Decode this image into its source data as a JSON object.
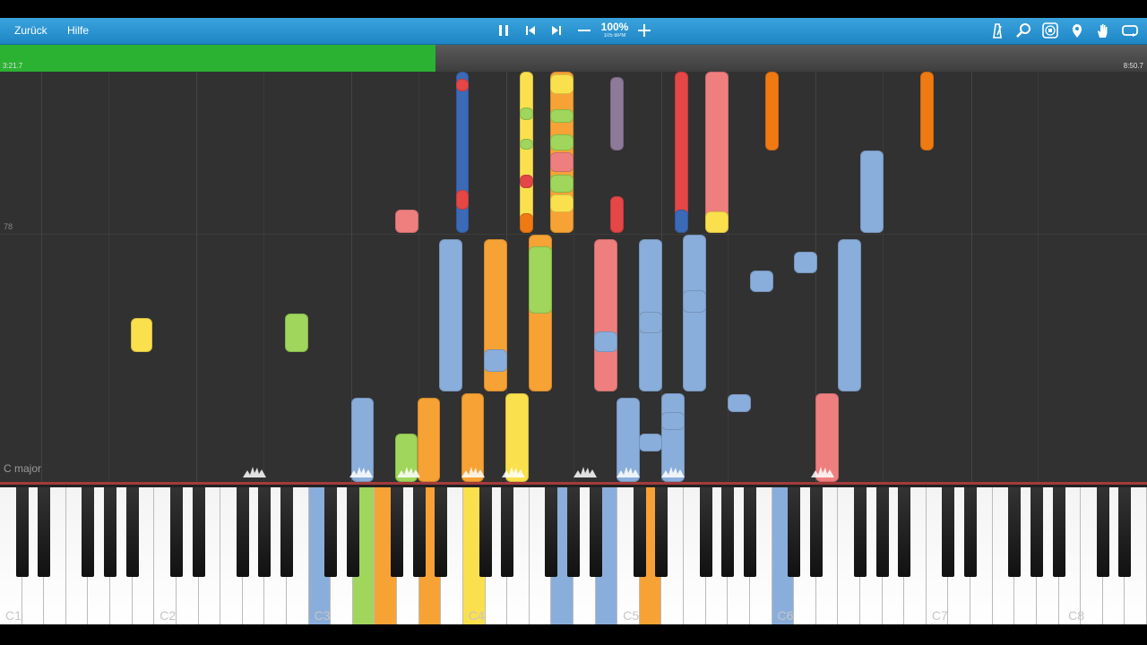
{
  "toolbar": {
    "back_label": "Zurück",
    "help_label": "Hilfe",
    "zoom_percent": "100%",
    "bpm_label": "105 BPM",
    "left_icons": [
      "pause-icon",
      "skip-back-icon",
      "skip-forward-icon",
      "minus-icon",
      "plus-icon"
    ],
    "right_icons": [
      "metronome-icon",
      "search-icon",
      "label-icon",
      "location-pin-icon",
      "hand-icon",
      "loop-icon"
    ]
  },
  "progress": {
    "elapsed": "3:21.7",
    "total": "8:50.7",
    "fraction": 0.38,
    "color": "#2bb233"
  },
  "roll": {
    "measure_number": "78",
    "key_signature": "C major",
    "colors": {
      "blue": "#8aaedb",
      "orange": "#f7a234",
      "green": "#9fd65b",
      "yellow": "#fbe04d",
      "pink": "#ef7f7f",
      "red": "#e54646",
      "purple": "#8e7a98",
      "darkblue": "#3a6ab8",
      "deeporange": "#f07a12"
    }
  },
  "keyboard": {
    "octave_labels": [
      "C1",
      "C2",
      "C3",
      "C4",
      "C5",
      "C6",
      "C7",
      "C8"
    ],
    "active_colors": {
      "C3": "#8aaedb",
      "E3": "#9fd65b",
      "F3": "#f7a234",
      "A3": "#f7a234",
      "C4": "#fbe04d",
      "G4": "#8aaedb",
      "B4": "#8aaedb",
      "D5": "#f7a234",
      "C6": "#8aaedb"
    }
  }
}
